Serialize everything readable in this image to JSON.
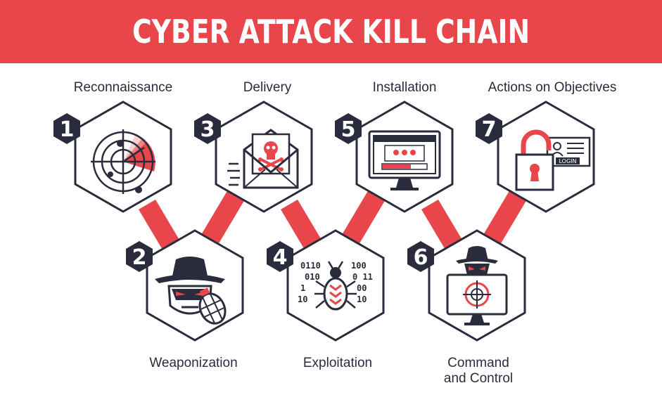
{
  "title": "CYBER ATTACK KILL CHAIN",
  "colors": {
    "banner": "#e8464a",
    "accent": "#e8464a",
    "dark": "#2a2c3d",
    "background": "#ffffff"
  },
  "steps": [
    {
      "number": "1",
      "label": "Reconnaissance",
      "icon": "radar-icon"
    },
    {
      "number": "2",
      "label": "Weaponization",
      "icon": "hacker-with-grenade-icon"
    },
    {
      "number": "3",
      "label": "Delivery",
      "icon": "malicious-email-icon"
    },
    {
      "number": "4",
      "label": "Exploitation",
      "icon": "bug-binary-icon",
      "binary_left": [
        "0110",
        "010",
        "1",
        "10"
      ],
      "binary_right": [
        "100",
        "0 11",
        "00",
        "10"
      ]
    },
    {
      "number": "5",
      "label": "Installation",
      "icon": "monitor-install-icon"
    },
    {
      "number": "6",
      "label_line1": "Command",
      "label_line2": "and Control",
      "icon": "hacker-target-monitor-icon"
    },
    {
      "number": "7",
      "label": "Actions on Objectives",
      "icon": "padlock-login-icon",
      "login_text": "LOGIN"
    }
  ]
}
